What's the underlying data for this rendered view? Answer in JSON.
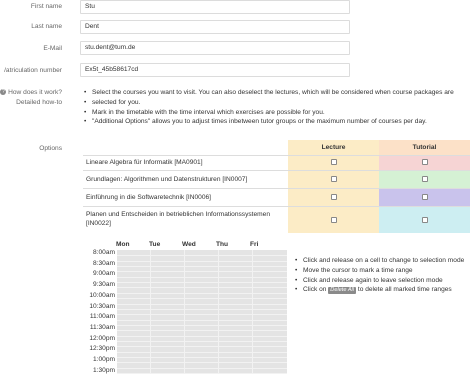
{
  "form": {
    "first_name": {
      "label": "First name",
      "value": "Stu"
    },
    "last_name": {
      "label": "Last name",
      "value": "Dent"
    },
    "email": {
      "label": "E-Mail",
      "value": "stu.dent@tum.de"
    },
    "matriculation": {
      "label": "Matriculation number",
      "label_visible": "/atriculation number",
      "value": "Ex5t_45b58617cd"
    }
  },
  "howto": {
    "question": "How does it work?",
    "detail": "Detailed how-to",
    "icon": "question-circle-icon",
    "items": [
      "Select the courses you want to visit. You can also deselect the lectures, which will be considered when course packages are",
      "selected for you.",
      "Mark in the timetable with the time interval which exercises are possible for you.",
      "\"Additional Options\" allows you to adjust times inbetween tutor groups or the maximum number of courses per day."
    ]
  },
  "options": {
    "label": "Options",
    "col_lecture": "Lecture",
    "col_tutorial": "Tutorial",
    "courses": [
      {
        "name": "Lineare Algebra für Informatik [MA0901]",
        "tut_color": "#f6d4d4"
      },
      {
        "name": "Grundlagen: Algorithmen und Datenstrukturen [IN0007]",
        "tut_color": "#d5f1d4"
      },
      {
        "name": "Einführung in die Softwaretechnik [IN0006]",
        "tut_color": "#c9c3ec"
      },
      {
        "name": "Planen und Entscheiden in betrieblichen Informationssystemen [IN0022]",
        "tut_color": "#cdeef2"
      }
    ],
    "lecture_color": "#fcecc6",
    "tutorial_header_color": "#fce1c8"
  },
  "schedule": {
    "days": [
      "Mon",
      "Tue",
      "Wed",
      "Thu",
      "Fri"
    ],
    "times": [
      "8:00am",
      "8:30am",
      "9:00am",
      "9:30am",
      "10:00am",
      "10:30am",
      "11:00am",
      "11:30am",
      "12:00pm",
      "12:30pm",
      "1:00pm",
      "1:30pm"
    ]
  },
  "instructions": {
    "items": [
      "Click and release on a cell to change to selection mode",
      "Move the cursor to mark a time range",
      "Click and release again to leave selection mode"
    ],
    "last_prefix": "Click on",
    "delete_all_label": "Delete All",
    "last_suffix": "to delete all marked time ranges"
  }
}
